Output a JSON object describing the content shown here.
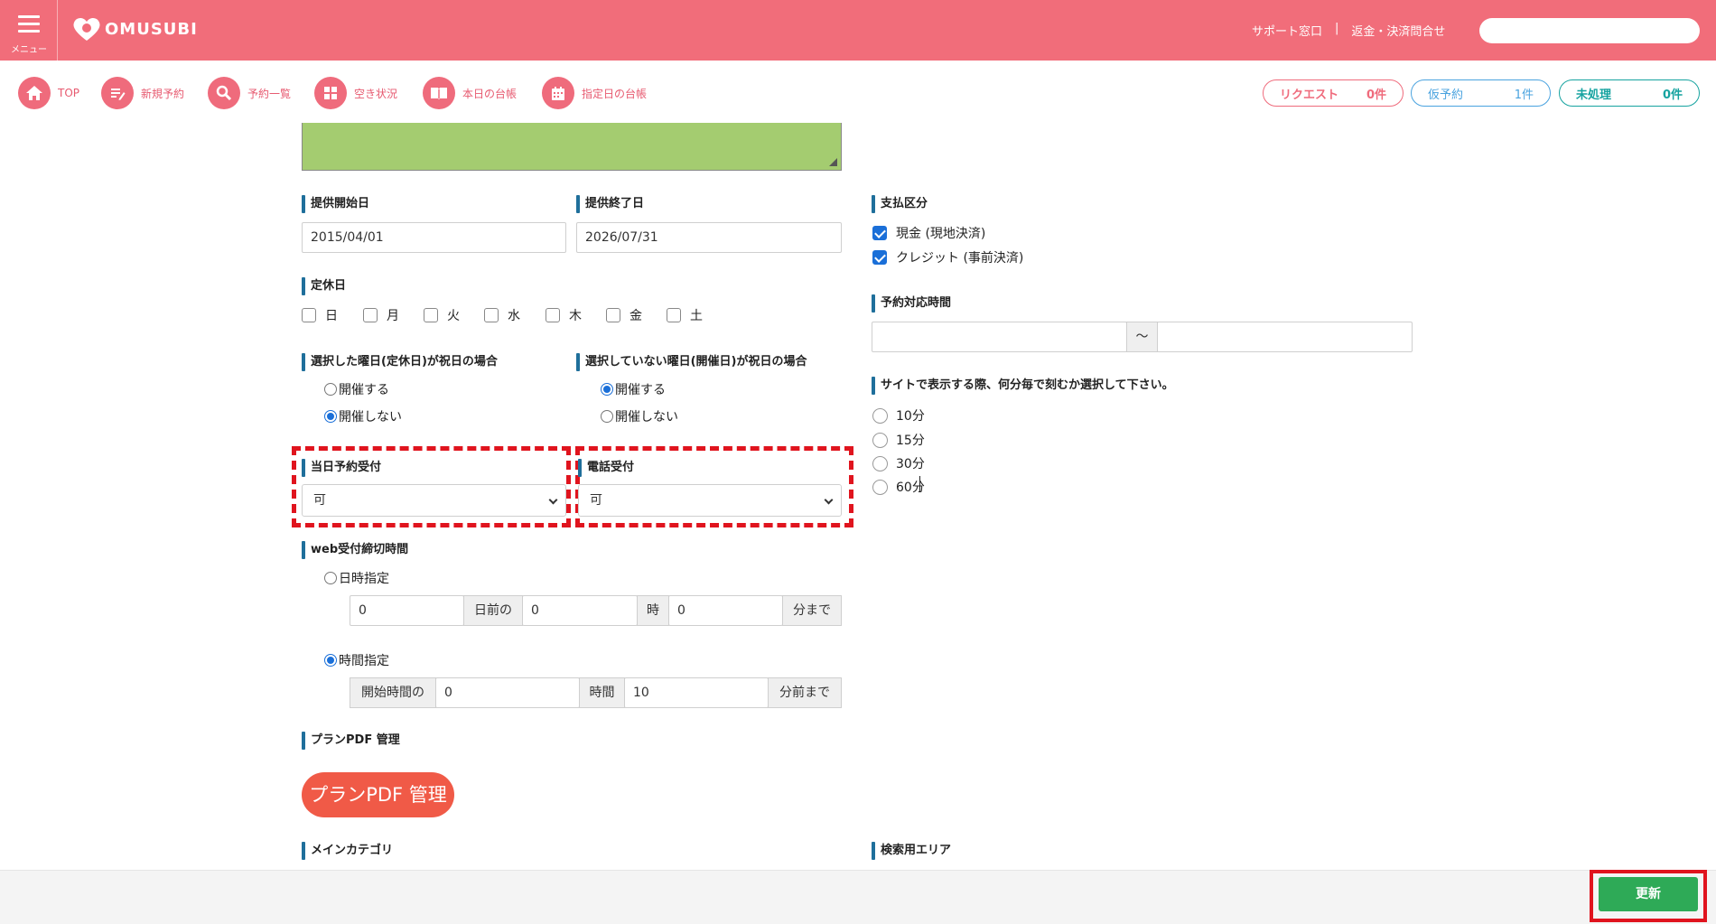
{
  "header": {
    "menu_label": "メニュー",
    "logo_text": "OMUSUBI",
    "links": [
      "サポート窓口",
      "|",
      "返金・決済問合せ"
    ],
    "search_placeholder": ""
  },
  "nav": {
    "items": [
      {
        "label": "TOP",
        "icon": "home-icon"
      },
      {
        "label": "新規予約",
        "icon": "pen-icon"
      },
      {
        "label": "予約一覧",
        "icon": "search-icon"
      },
      {
        "label": "空き状況",
        "icon": "grid-icon"
      },
      {
        "label": "本日の台帳",
        "icon": "book-icon"
      },
      {
        "label": "指定日の台帳",
        "icon": "calendar-icon"
      }
    ],
    "badges": [
      {
        "label": "リクエスト",
        "count": "0件",
        "color": "#ef6b7c"
      },
      {
        "label": "仮予約",
        "count": "1件",
        "color": "#4aa3df"
      },
      {
        "label": "未処理",
        "count": "0件",
        "color": "#16a3a0"
      }
    ]
  },
  "form": {
    "start_date": {
      "label": "提供開始日",
      "value": "2015/04/01"
    },
    "end_date": {
      "label": "提供終了日",
      "value": "2026/07/31"
    },
    "payment": {
      "label": "支払区分",
      "options": [
        {
          "label": "現金 (現地決済)",
          "checked": true
        },
        {
          "label": "クレジット (事前決済)",
          "checked": true
        }
      ]
    },
    "holidays": {
      "label": "定休日",
      "days": [
        "日",
        "月",
        "火",
        "水",
        "木",
        "金",
        "土"
      ]
    },
    "reservation_time": {
      "label": "予約対応時間",
      "separator": "〜",
      "from": "",
      "to": ""
    },
    "holiday_selected": {
      "label": "選択した曜日(定休日)が祝日の場合",
      "options": [
        {
          "label": "開催する",
          "checked": false
        },
        {
          "label": "開催しない",
          "checked": true
        }
      ]
    },
    "holiday_unselected": {
      "label": "選択していない曜日(開催日)が祝日の場合",
      "options": [
        {
          "label": "開催する",
          "checked": true
        },
        {
          "label": "開催しない",
          "checked": false
        }
      ]
    },
    "interval": {
      "label": "サイトで表示する際、何分毎で刻むか選択して下さい。",
      "options": [
        "10分",
        "15分",
        "30分",
        "60分"
      ]
    },
    "same_day": {
      "label": "当日予約受付",
      "value": "可"
    },
    "phone": {
      "label": "電話受付",
      "value": "可"
    },
    "web_deadline": {
      "label": "web受付締切時間",
      "date_option": "日時指定",
      "date_fields": {
        "days": "0",
        "days_unit": "日前の",
        "hour": "0",
        "hour_unit": "時",
        "minute": "0",
        "minute_unit": "分まで"
      },
      "time_option": "時間指定",
      "time_fields": {
        "prefix": "開始時間の",
        "hours": "0",
        "hours_unit": "時間",
        "minutes": "10",
        "minutes_unit": "分前まで"
      }
    },
    "pdf": {
      "label": "プランPDF 管理",
      "button": "プランPDF 管理"
    },
    "main_category_label": "メインカテゴリ",
    "search_area_label": "検索用エリア"
  },
  "footer": {
    "update_button": "更新"
  },
  "colors": {
    "header": "#f16d7a",
    "accent_bar": "#1f6f9b",
    "update": "#2eaa57",
    "highlight": "#e0141e",
    "pdf_button": "#f05a47"
  }
}
